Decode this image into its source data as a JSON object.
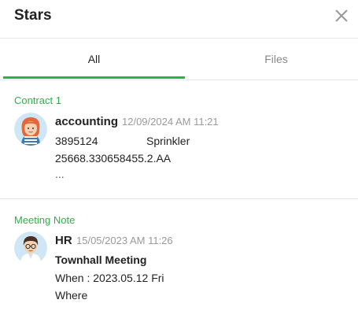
{
  "panel": {
    "title": "Stars",
    "close_icon": "close-icon"
  },
  "tabs": [
    {
      "label": "All",
      "active": true
    },
    {
      "label": "Files",
      "active": false
    }
  ],
  "accent_color": "#2bb24c",
  "items": [
    {
      "category": "Contract 1",
      "sender": "accounting",
      "time": "12/09/2024 AM 11:21",
      "avatar": "female-avatar",
      "lines": [
        "3895124",
        "Sprinkler",
        "25668.330658455.2.AA",
        "..."
      ]
    },
    {
      "category": "Meeting Note",
      "sender": "HR",
      "time": "15/05/2023 AM 11:26",
      "avatar": "male-avatar",
      "lines": [
        "Townhall Meeting",
        "When : 2023.05.12 Fri",
        "Where"
      ]
    }
  ]
}
